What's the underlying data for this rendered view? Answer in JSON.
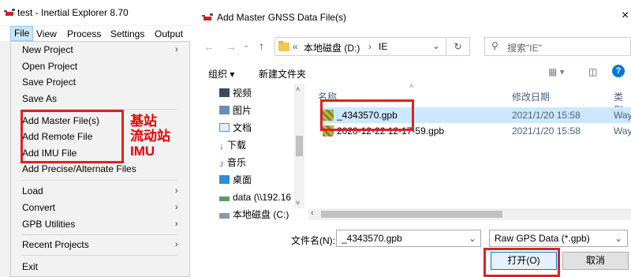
{
  "left_window": {
    "title": "test - Inertial Explorer 8.70",
    "menubar": [
      "File",
      "View",
      "Process",
      "Settings",
      "Output"
    ],
    "file_menu": {
      "group1": [
        {
          "label": "New Project",
          "has_submenu": true
        },
        {
          "label": "Open Project",
          "has_submenu": false
        },
        {
          "label": "Save Project",
          "has_submenu": false
        },
        {
          "label": "Save As",
          "has_submenu": false
        }
      ],
      "group2": [
        {
          "label": "Add Master File(s)"
        },
        {
          "label": "Add Remote File"
        },
        {
          "label": "Add IMU File"
        },
        {
          "label": "Add Precise/Alternate Files"
        }
      ],
      "group3": [
        {
          "label": "Load",
          "has_submenu": true
        },
        {
          "label": "Convert",
          "has_submenu": true
        },
        {
          "label": "GPB Utilities",
          "has_submenu": true
        }
      ],
      "group4": [
        {
          "label": "Recent Projects",
          "has_submenu": true
        }
      ],
      "group5": [
        {
          "label": "Exit"
        }
      ]
    },
    "annotations": [
      "基站",
      "流动站",
      "IMU"
    ],
    "submenu_arrow": "›"
  },
  "dialog": {
    "title": "Add Master GNSS Data File(s)",
    "close": "×",
    "path": {
      "prefix": "«",
      "segments": [
        "本地磁盘 (D:)",
        "IE"
      ]
    },
    "search_placeholder": "搜索\"IE\"",
    "toolbar": {
      "organize": "组织 ▾",
      "new_folder": "新建文件夹"
    },
    "tree": [
      {
        "label": "视频",
        "icon": "video-icon"
      },
      {
        "label": "图片",
        "icon": "picture-icon"
      },
      {
        "label": "文档",
        "icon": "document-icon"
      },
      {
        "label": "下载",
        "icon": "download-icon"
      },
      {
        "label": "音乐",
        "icon": "music-icon"
      },
      {
        "label": "桌面",
        "icon": "desktop-icon"
      },
      {
        "label": "data (\\\\192.16",
        "icon": "network-drive-icon"
      },
      {
        "label": "本地磁盘 (C:)",
        "icon": "drive-icon"
      }
    ],
    "columns": {
      "name": "名称",
      "modified": "修改日期",
      "type": "类型"
    },
    "files": [
      {
        "name": "_4343570.gpb",
        "modified": "2021/1/20 15:58",
        "type": "Way",
        "selected": true
      },
      {
        "name": "2020-12-22 12-17-59.gpb",
        "modified": "2021/1/20 15:58",
        "type": "Way",
        "selected": false
      }
    ],
    "filename_label": "文件名(N):",
    "filename_value": "_4343570.gpb",
    "filetype_value": "Raw GPS Data (*.gpb)",
    "open_button": "打开(O)",
    "cancel_button": "取消"
  },
  "colors": {
    "annotation_red": "#e02020",
    "selection_blue": "#cce8ff",
    "brand_accent": "#0078d7"
  }
}
